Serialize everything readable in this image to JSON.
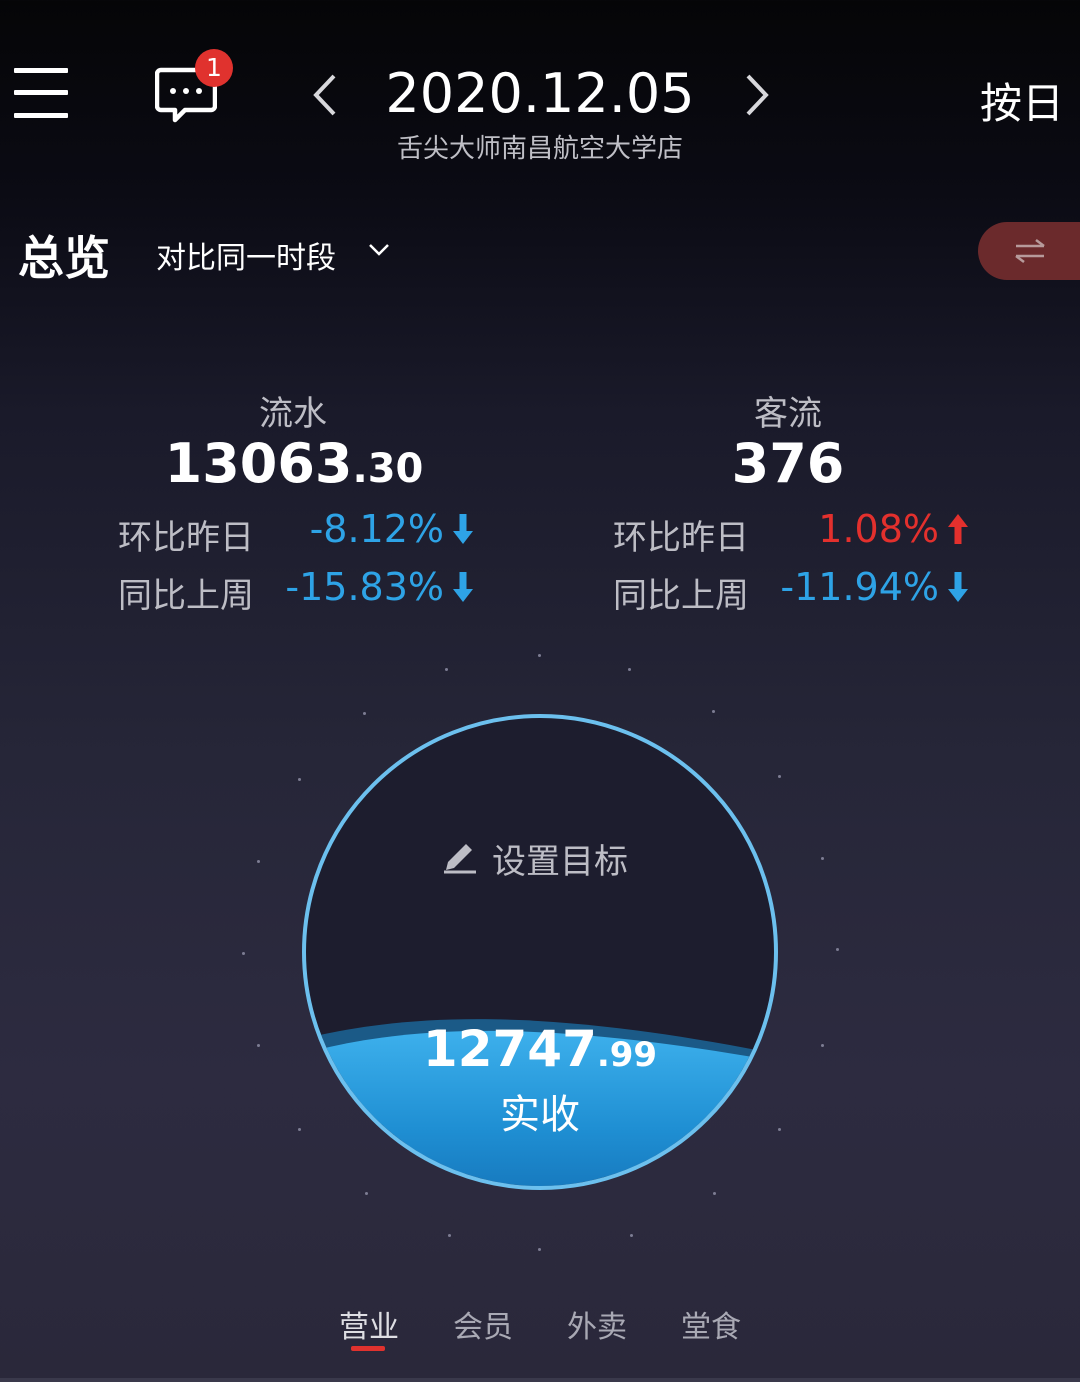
{
  "header": {
    "date": "2020.12.05",
    "store_name": "舌尖大师南昌航空大学店",
    "mode_label": "按日",
    "message_count": "1"
  },
  "overview": {
    "title": "总览",
    "compare_label": "对比同一时段"
  },
  "metrics": {
    "flow": {
      "label": "流水",
      "value_int": "13063",
      "value_dec": ".30",
      "dod_label": "环比昨日",
      "dod_value": "-8.12%",
      "wow_label": "同比上周",
      "wow_value": "-15.83%"
    },
    "traffic": {
      "label": "客流",
      "value": "376",
      "dod_label": "环比昨日",
      "dod_value": "1.08%",
      "wow_label": "同比上周",
      "wow_value": "-11.94%"
    }
  },
  "gauge": {
    "set_target_label": "设置目标",
    "amount_int": "12747",
    "amount_dec": ".99",
    "amount_label": "实收"
  },
  "tabs": [
    {
      "label": "营业"
    },
    {
      "label": "会员"
    },
    {
      "label": "外卖"
    },
    {
      "label": "堂食"
    }
  ],
  "colors": {
    "down": "#2ea3e6",
    "up": "#e3302d",
    "badge": "#e0322e",
    "water": "#2a9fe0"
  }
}
